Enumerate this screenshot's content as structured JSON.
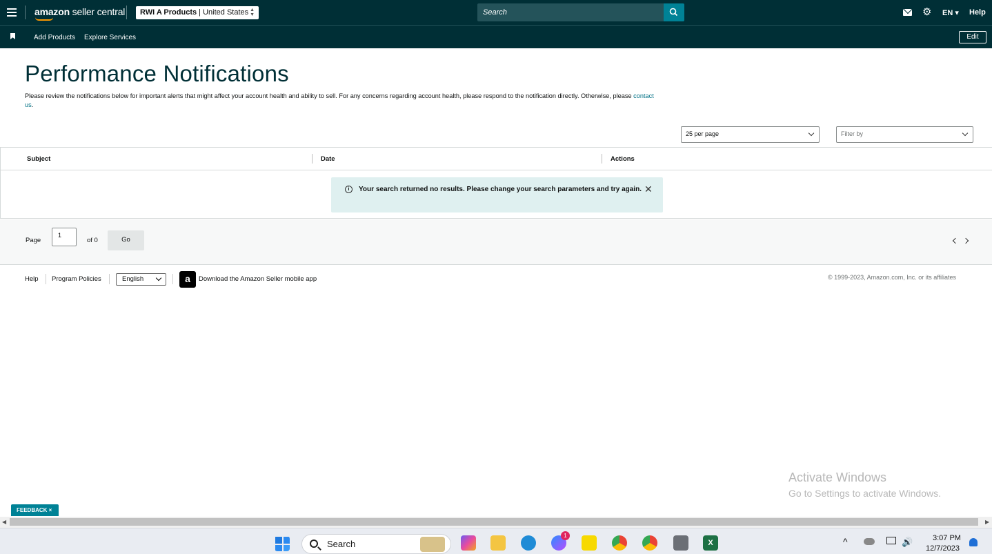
{
  "header": {
    "logo_brand": "amazon",
    "logo_product": "seller central",
    "store_name": "RWI A Products",
    "store_region": "United States",
    "search_placeholder": "Search",
    "language": "EN",
    "help": "Help"
  },
  "subnav": {
    "items": [
      "Add Products",
      "Explore Services"
    ],
    "edit": "Edit"
  },
  "page": {
    "title": "Performance Notifications",
    "description": "Please review the notifications below for important alerts that might affect your account health and ability to sell. For any concerns regarding account health, please respond to the notification directly. Otherwise, please",
    "contact_link": "contact us",
    "description_end": "."
  },
  "controls": {
    "per_page": "25 per page",
    "filter_placeholder": "Filter by"
  },
  "table": {
    "columns": [
      "Subject",
      "Date",
      "Actions"
    ],
    "empty_message": "Your search returned no results. Please change your search parameters and try again."
  },
  "pager": {
    "page_label": "Page",
    "page_value": "1",
    "of_label": "of 0",
    "go": "Go"
  },
  "footer": {
    "help": "Help",
    "policies": "Program Policies",
    "language": "English",
    "app_icon_letter": "a",
    "app_download": "Download the Amazon Seller mobile app",
    "copyright": "© 1999-2023, Amazon.com, Inc. or its affiliates"
  },
  "watermark": {
    "line1": "Activate Windows",
    "line2": "Go to Settings to activate Windows."
  },
  "feedback": "FEEDBACK ×",
  "taskbar": {
    "search": "Search",
    "messenger_badge": "1",
    "time": "3:07 PM",
    "date": "12/7/2023"
  },
  "colors": {
    "nav_bg": "#002f36",
    "accent": "#008296",
    "alert_bg": "#dff0f0"
  }
}
